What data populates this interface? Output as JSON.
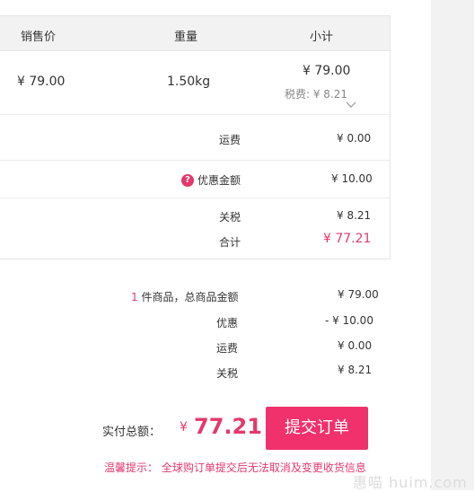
{
  "table": {
    "headers": {
      "price": "销售价",
      "weight": "重量",
      "subtotal": "小计"
    },
    "item": {
      "price": "¥ 79.00",
      "weight": "1.50kg",
      "subtotal": "¥ 79.00",
      "tax_note": "税费: ¥ 8.21"
    }
  },
  "summary_box": {
    "shipping_label": "运费",
    "shipping_value": "¥ 0.00",
    "discount_label": "优惠金额",
    "discount_value": "¥ 10.00",
    "tariff_label": "关税",
    "tariff_value": "¥ 8.21",
    "total_label": "合计",
    "total_value": "¥ 77.21"
  },
  "totals": {
    "count": "1",
    "count_text": " 件商品，总商品金额",
    "goods_value": "¥ 79.00",
    "discount_label": "优惠",
    "discount_value": "- ¥ 10.00",
    "shipping_label": "运费",
    "shipping_value": "¥ 0.00",
    "tariff_label": "关税",
    "tariff_value": "¥ 8.21"
  },
  "payment": {
    "label": "实付总额：",
    "currency": "¥",
    "amount": "77.21",
    "submit_label": "提交订单"
  },
  "notice": "温馨提示：  全球购订单提交后无法取消及变更收货信息",
  "watermark": "惠喵 huim.com",
  "colors": {
    "accent": "#e4396c",
    "button": "#f0316c",
    "header_bg": "#f2f2f2"
  },
  "icons": {
    "question": "question-icon",
    "chevron": "chevron-down-icon"
  }
}
